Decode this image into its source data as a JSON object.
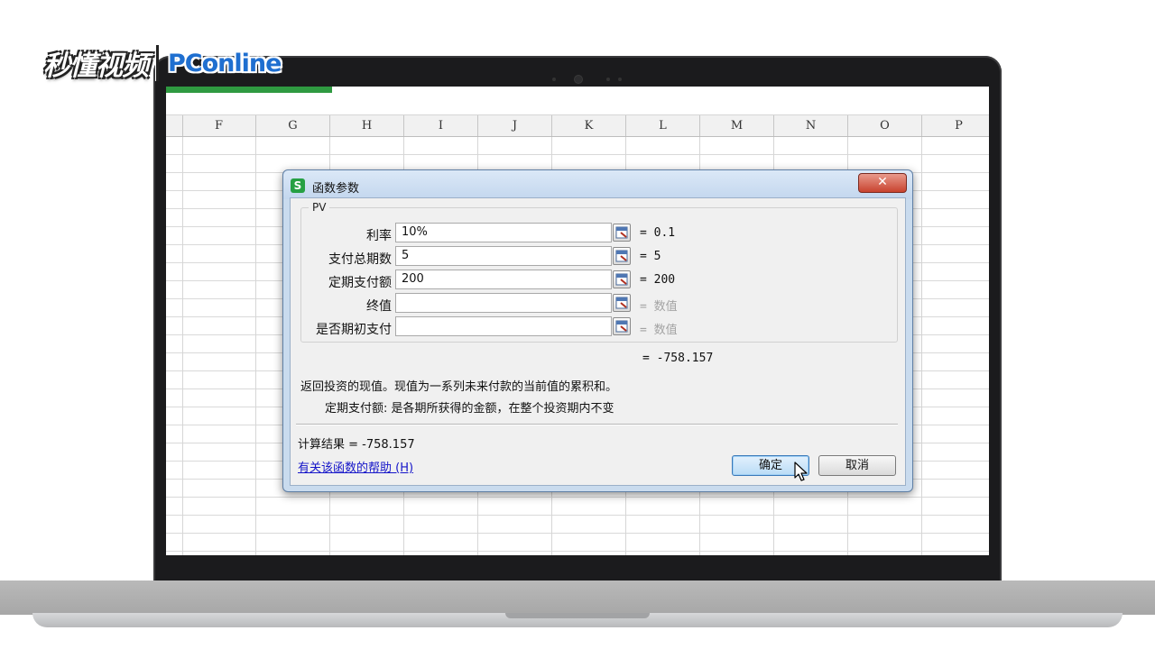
{
  "watermark": {
    "brand_left": "秒懂视频",
    "brand_right": "PConline"
  },
  "spreadsheet": {
    "columns": [
      "F",
      "G",
      "H",
      "I",
      "J",
      "K",
      "L",
      "M",
      "N",
      "O",
      "P"
    ]
  },
  "dialog": {
    "title": "函数参数",
    "close_symbol": "✕",
    "function_name": "PV",
    "params": [
      {
        "label": "利率",
        "value": "10%",
        "result": "= 0.1",
        "dim": false
      },
      {
        "label": "支付总期数",
        "value": "5",
        "result": "= 5",
        "dim": false
      },
      {
        "label": "定期支付额",
        "value": "200",
        "result": "= 200",
        "dim": false
      },
      {
        "label": "终值",
        "value": "",
        "result": "= 数值",
        "dim": true
      },
      {
        "label": "是否期初支付",
        "value": "",
        "result": "= 数值",
        "dim": true
      }
    ],
    "formula_result": "= -758.157",
    "description": "返回投资的现值。现值为一系列未来付款的当前值的累积和。",
    "param_description": "定期支付额:  是各期所获得的金额，在整个投资期内不变",
    "calc_result": "计算结果 = -758.157",
    "help_link": "有关该函数的帮助 (H)",
    "ok_label": "确定",
    "cancel_label": "取消"
  },
  "colors": {
    "accent_green": "#2f9a41",
    "dialog_frame": "#c9dbee",
    "close_red": "#c8432f",
    "link_blue": "#1515c9"
  }
}
